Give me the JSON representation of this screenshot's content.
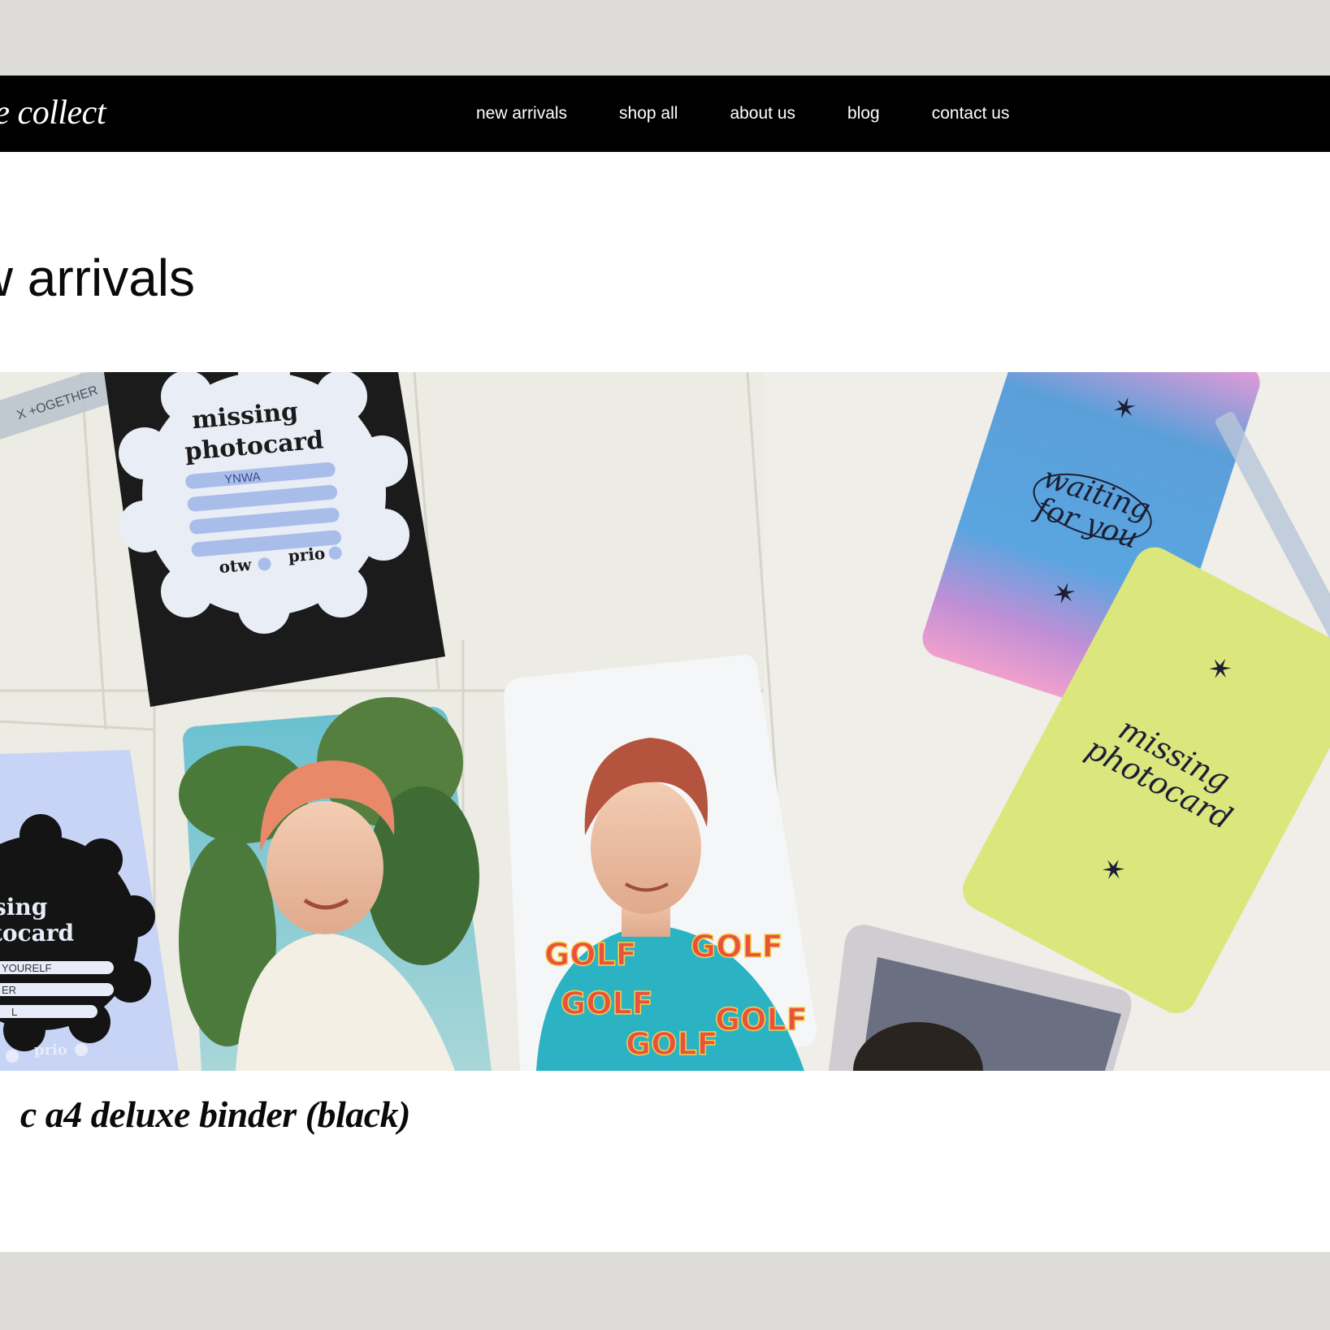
{
  "brand": {
    "name": "le collect"
  },
  "nav": {
    "items": [
      {
        "label": "new arrivals"
      },
      {
        "label": "shop all"
      },
      {
        "label": "about us"
      },
      {
        "label": "blog"
      },
      {
        "label": "contact us"
      }
    ]
  },
  "page": {
    "title": "w arrivals"
  },
  "product": {
    "title": "c a4 deluxe binder (black)",
    "image": {
      "card_black": {
        "heading1": "missing",
        "heading2": "photocard",
        "handwriting": "YNWA",
        "check1": "otw",
        "check2": "prio"
      },
      "card_blue": {
        "heading1": "sing",
        "heading2": "tocard",
        "line1": "YOURELF",
        "line2": "ER",
        "line3": "L",
        "check2": "prio"
      },
      "card_gradient": {
        "line1": "waiting",
        "line2": "for you"
      },
      "card_yellow": {
        "line1": "missing",
        "line2": "photocard"
      },
      "sleeve_label": "X +OGETHER",
      "shirt_text": "GOLF"
    }
  },
  "colors": {
    "page_bg": "#dedcd9",
    "nav_bg": "#000000",
    "content_bg": "#ffffff",
    "text": "#0a0a0a"
  }
}
